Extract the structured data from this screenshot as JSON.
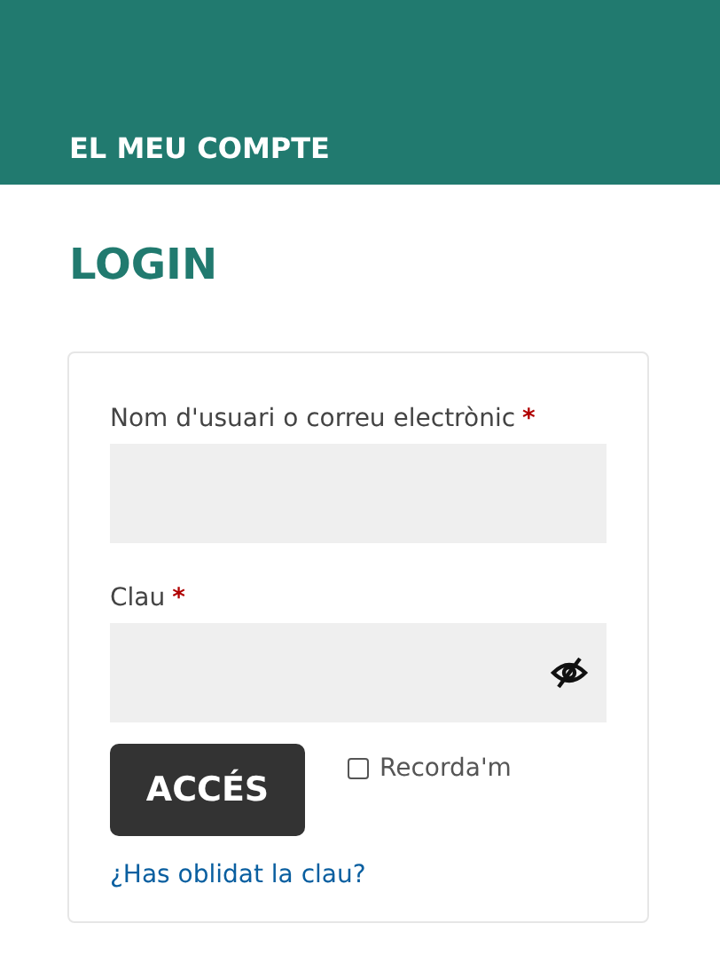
{
  "header": {
    "title": "EL MEU COMPTE"
  },
  "heading": "LOGIN",
  "form": {
    "fields": [
      {
        "label": "Nom d'usuari o correu electrònic",
        "required_mark": "*",
        "kind": "text"
      },
      {
        "label": "Clau",
        "required_mark": "*",
        "kind": "password"
      }
    ],
    "submit": "ACCÉS",
    "remember": {
      "label": "Recorda'm",
      "checked": false
    },
    "forgot_link": "¿Has oblidat la clau?"
  }
}
